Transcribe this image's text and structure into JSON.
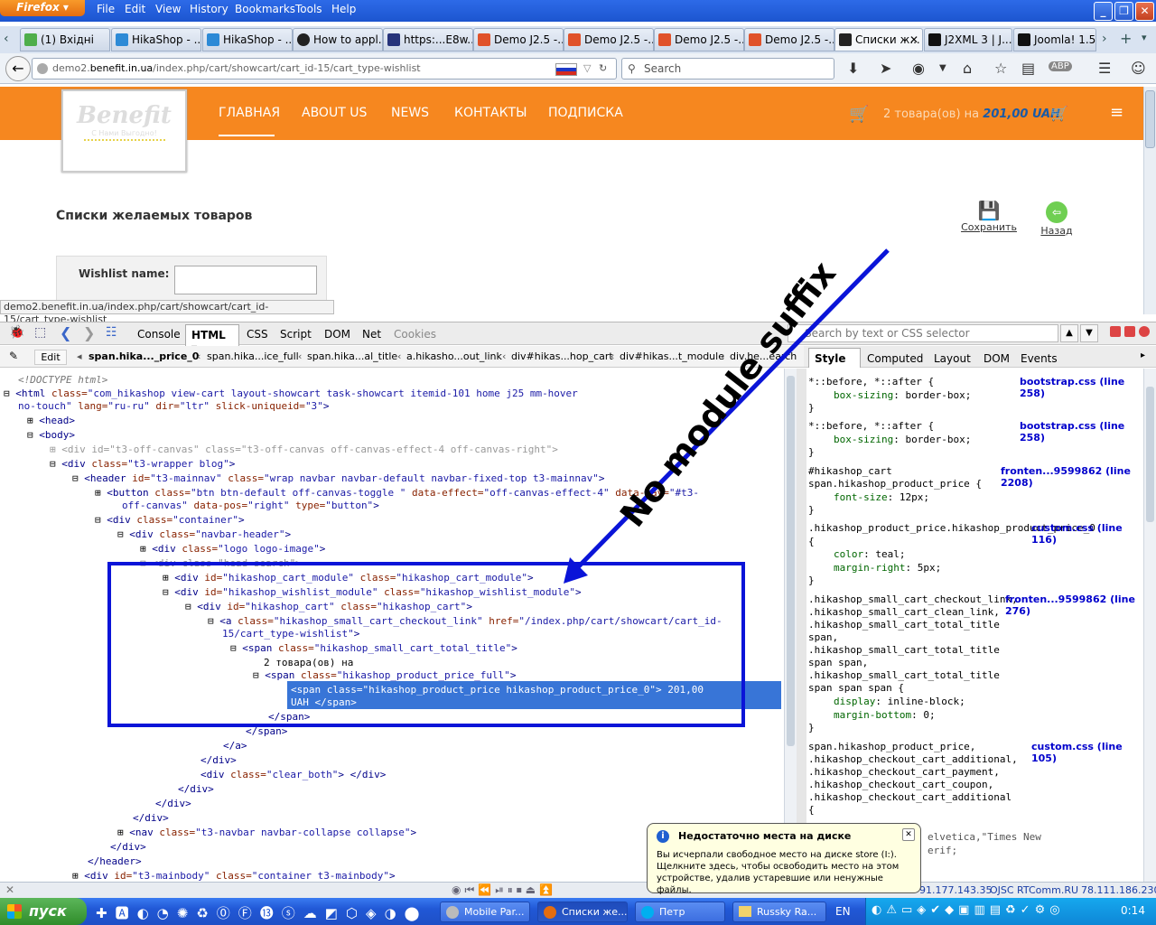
{
  "browser": {
    "app_name": "Firefox",
    "menu": [
      "File",
      "Edit",
      "View",
      "History",
      "Bookmarks",
      "Tools",
      "Help"
    ],
    "tabs": [
      {
        "label": "(1) Вхідні"
      },
      {
        "label": "HikaShop - ..."
      },
      {
        "label": "HikaShop - ..."
      },
      {
        "label": "How to appl..."
      },
      {
        "label": "https:...E8w..."
      },
      {
        "label": "Demo J2.5 -..."
      },
      {
        "label": "Demo J2.5 -..."
      },
      {
        "label": "Demo J2.5 -..."
      },
      {
        "label": "Demo J2.5 -..."
      },
      {
        "label": "Списки ж..."
      },
      {
        "label": "J2XML 3 | J..."
      },
      {
        "label": "Joomla! 1.5 ..."
      }
    ],
    "url_prefix": "demo2.",
    "url_domain": "benefit.in.ua",
    "url_path": "/index.php/cart/showcart/cart_id-15/cart_type-wishlist",
    "search_placeholder": "Search",
    "status_url": "demo2.benefit.in.ua/index.php/cart/showcart/cart_id-15/cart_type-wishlist"
  },
  "site": {
    "logo_text": "Benefit",
    "logo_sub": "С Нами Выгодно!",
    "nav": [
      "ГЛАВНАЯ",
      "ABOUT US",
      "NEWS",
      "КОНТАКТЫ",
      "ПОДПИСКА"
    ],
    "cart_summary": "2 товара(ов) на",
    "cart_price": "201,00 UAH",
    "page_title": "Списки желаемых товаров",
    "save_label": "Сохранить",
    "back_label": "Назад",
    "wishlist_name_label": "Wishlist name:"
  },
  "firebug": {
    "tabs": [
      "Console",
      "HTML",
      "CSS",
      "Script",
      "DOM",
      "Net",
      "Cookies"
    ],
    "search_placeholder": "Search by text or CSS selector",
    "edit_label": "Edit",
    "breadcrumbs": [
      "span.hika..._price_0",
      "span.hika...ice_full",
      "span.hika...al_title",
      "a.hikasho...out_link",
      "div#hikas...hop_cart",
      "div#hikas...t_module",
      "div.he...earch"
    ],
    "side_tabs": [
      "Style",
      "Computed",
      "Layout",
      "DOM",
      "Events"
    ]
  },
  "annotation": {
    "text": "No module suffix",
    "color": "#0a14d8"
  },
  "balloon": {
    "title": "Недостаточно места на диске",
    "body": "Вы исчерпали свободное место на диске store (I:). Щелкните здесь, чтобы освободить место на этом устройстве, удалив устаревшие или ненужные файлы."
  },
  "statusbar": {
    "ip1": "91.177.143.35",
    "isp": "OJSC RTComm.RU",
    "ip2": "78.111.186.230"
  },
  "taskbar": {
    "start": "пуск",
    "tasks": [
      "Mobile Par...",
      "Списки же...",
      "Петр",
      "Russky Ra..."
    ],
    "lang": "EN",
    "clock": "0:14"
  },
  "colors": {
    "orange": "#f6871f",
    "selection": "#3875d7",
    "annotation_blue": "#0a14d8"
  }
}
